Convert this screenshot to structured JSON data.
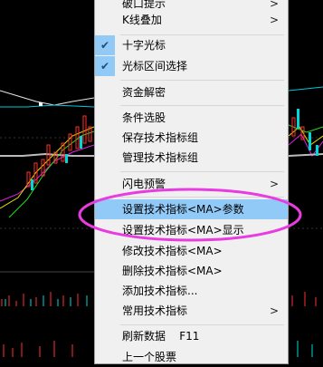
{
  "menu": {
    "items": [
      {
        "label": "破口提示",
        "arrow": true
      },
      {
        "label": "K线叠加",
        "arrow": true
      },
      {
        "label": "十字光标",
        "checked": true
      },
      {
        "label": "光标区间选择",
        "checked": true
      },
      {
        "label": "资金解密"
      },
      {
        "label": "条件选股"
      },
      {
        "label": "保存技术指标组"
      },
      {
        "label": "管理技术指标组"
      },
      {
        "label": "闪电预警",
        "arrow": true
      },
      {
        "label": "设置技术指标<MA>参数",
        "highlighted": true
      },
      {
        "label": "设置技术指标<MA>显示"
      },
      {
        "label": "修改技术指标<MA>"
      },
      {
        "label": "删除技术指标<MA>"
      },
      {
        "label": "添加技术指标..."
      },
      {
        "label": "常用技术指标",
        "arrow": true
      },
      {
        "label": "刷新数据    F11"
      },
      {
        "label": "上一个股票"
      }
    ],
    "arrow_glyph": ">",
    "check_glyph": "✔"
  },
  "colors": {
    "highlight": "#91c9f7",
    "ellipse": "#e83be0",
    "menu_bg": "#f0f0f0",
    "background": "#000000"
  }
}
